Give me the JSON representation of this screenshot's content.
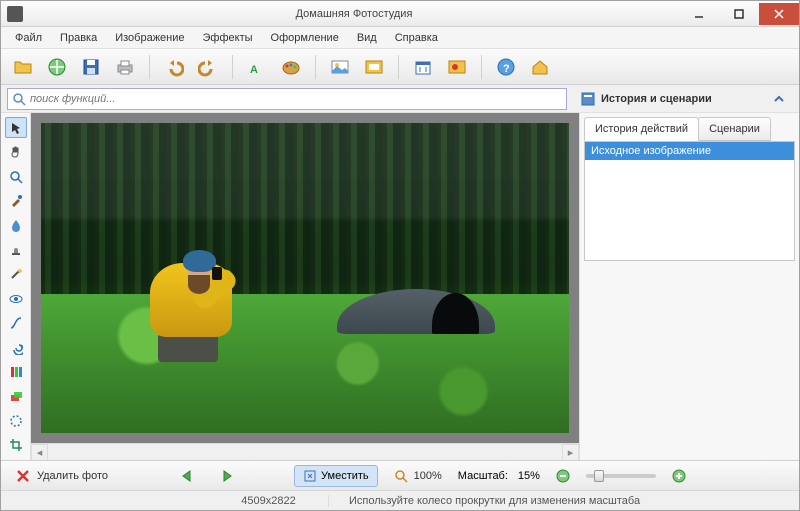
{
  "window": {
    "title": "Домашняя Фотостудия"
  },
  "menu": [
    "Файл",
    "Правка",
    "Изображение",
    "Эффекты",
    "Оформление",
    "Вид",
    "Справка"
  ],
  "search": {
    "placeholder": "поиск функций..."
  },
  "rightpanel": {
    "title": "История и сценарии",
    "tabs": [
      "История действий",
      "Сценарии"
    ],
    "history": [
      "Исходное изображение"
    ]
  },
  "bottom": {
    "delete": "Удалить фото",
    "fit": "Уместить",
    "zoom_reset": "100%",
    "scale_label": "Масштаб:",
    "scale_value": "15%"
  },
  "status": {
    "dimensions": "4509x2822",
    "hint": "Используйте колесо прокрутки для изменения масштаба"
  }
}
